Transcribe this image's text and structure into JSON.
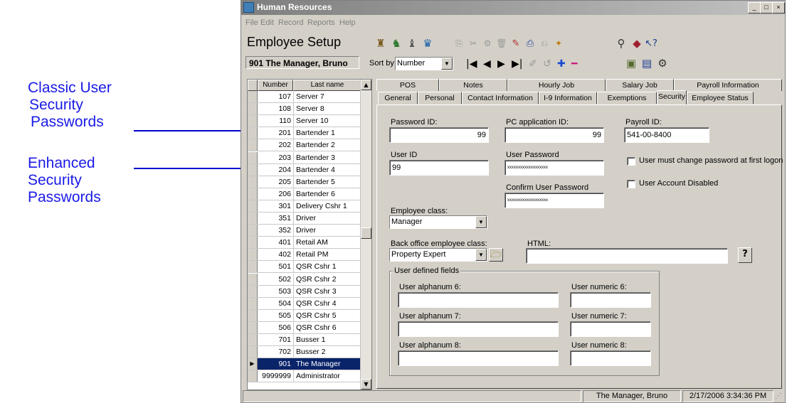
{
  "callouts": {
    "classic": [
      "Classic User",
      "Security",
      "Passwords"
    ],
    "enhanced": [
      "Enhanced",
      "Security",
      "Passwords"
    ]
  },
  "window": {
    "title": "Human Resources",
    "controls": [
      "_",
      "□",
      "×"
    ]
  },
  "menu": [
    "File",
    "Edit",
    "Record",
    "Reports",
    "Help"
  ],
  "header": {
    "title": "Employee Setup",
    "current_employee": "901  The Manager, Bruno",
    "sort_label": "Sort by:",
    "sort_value": "Number"
  },
  "toolbar_icons": [
    "employees-icon",
    "new-employee-icon",
    "search-employee-icon",
    "employee-group-icon",
    "copy-icon",
    "paste-icon",
    "cut-icon",
    "delete-icon",
    "import-icon",
    "export-icon",
    "print-icon",
    "tools-icon",
    "find-icon",
    "book-icon",
    "help-icon"
  ],
  "nav_icons": [
    "|◀",
    "◀",
    "▶",
    "▶|",
    "✐",
    "↺",
    "✚",
    "━"
  ],
  "list": {
    "headers": [
      "Number",
      "Last name"
    ],
    "rows": [
      {
        "number": "107",
        "name": "Server 7"
      },
      {
        "number": "108",
        "name": "Server 8"
      },
      {
        "number": "110",
        "name": "Server 10"
      },
      {
        "number": "201",
        "name": "Bartender 1"
      },
      {
        "number": "202",
        "name": "Bartender 2"
      },
      {
        "number": "203",
        "name": "Bartender 3"
      },
      {
        "number": "204",
        "name": "Bartender 4"
      },
      {
        "number": "205",
        "name": "Bartender 5"
      },
      {
        "number": "206",
        "name": "Bartender 6"
      },
      {
        "number": "301",
        "name": "Delivery Cshr 1"
      },
      {
        "number": "351",
        "name": "Driver"
      },
      {
        "number": "352",
        "name": "Driver"
      },
      {
        "number": "401",
        "name": "Retail AM"
      },
      {
        "number": "402",
        "name": "Retail PM"
      },
      {
        "number": "501",
        "name": "QSR Cshr 1"
      },
      {
        "number": "502",
        "name": "QSR Cshr 2"
      },
      {
        "number": "503",
        "name": "QSR Cshr 3"
      },
      {
        "number": "504",
        "name": "QSR Cshr 4"
      },
      {
        "number": "505",
        "name": "QSR Cshr 5"
      },
      {
        "number": "506",
        "name": "QSR Cshr 6"
      },
      {
        "number": "701",
        "name": "Busser 1"
      },
      {
        "number": "702",
        "name": "Busser 2"
      },
      {
        "number": "901",
        "name": "The Manager"
      },
      {
        "number": "9999999",
        "name": "Administrator"
      }
    ],
    "selected_number": "901"
  },
  "tabs": {
    "row1": [
      "POS",
      "Notes",
      "Hourly Job",
      "Salary Job",
      "Payroll Information"
    ],
    "row2": [
      "General",
      "Personal",
      "Contact Information",
      "I-9 Information",
      "Exemptions",
      "Security",
      "Employee Status"
    ],
    "active": "Security"
  },
  "security": {
    "password_id_label": "Password ID:",
    "password_id_value": "99",
    "pc_app_id_label": "PC application ID:",
    "pc_app_id_value": "99",
    "payroll_id_label": "Payroll ID:",
    "payroll_id_value": "541-00-8400",
    "user_id_label": "User ID",
    "user_id_value": "99",
    "user_password_label": "User Password",
    "user_password_value": "xxxxxxxxxxxxxxxxxxx",
    "confirm_password_label": "Confirm User Password",
    "confirm_password_value": "xxxxxxxxxxxxxxxxxxx",
    "must_change_label": "User must change password at first logon",
    "account_disabled_label": "User Account Disabled",
    "employee_class_label": "Employee class:",
    "employee_class_value": "Manager",
    "back_office_label": "Back office employee class:",
    "back_office_value": "Property Expert",
    "html_label": "HTML:",
    "html_value": "",
    "udf_title": "User defined fields",
    "udf": {
      "alpha6": "User alphanum 6:",
      "num6": "User numeric 6:",
      "alpha7": "User alphanum 7:",
      "num7": "User numeric 7:",
      "alpha8": "User alphanum 8:",
      "num8": "User numeric 8:"
    }
  },
  "status": {
    "user": "The Manager, Bruno",
    "datetime": "2/17/2006 3:34:36 PM"
  },
  "colors": {
    "callout_text": "#1a1ae6",
    "arrow": "#0000cc",
    "selection": "#0a246a",
    "window_face": "#d4d0c8"
  }
}
